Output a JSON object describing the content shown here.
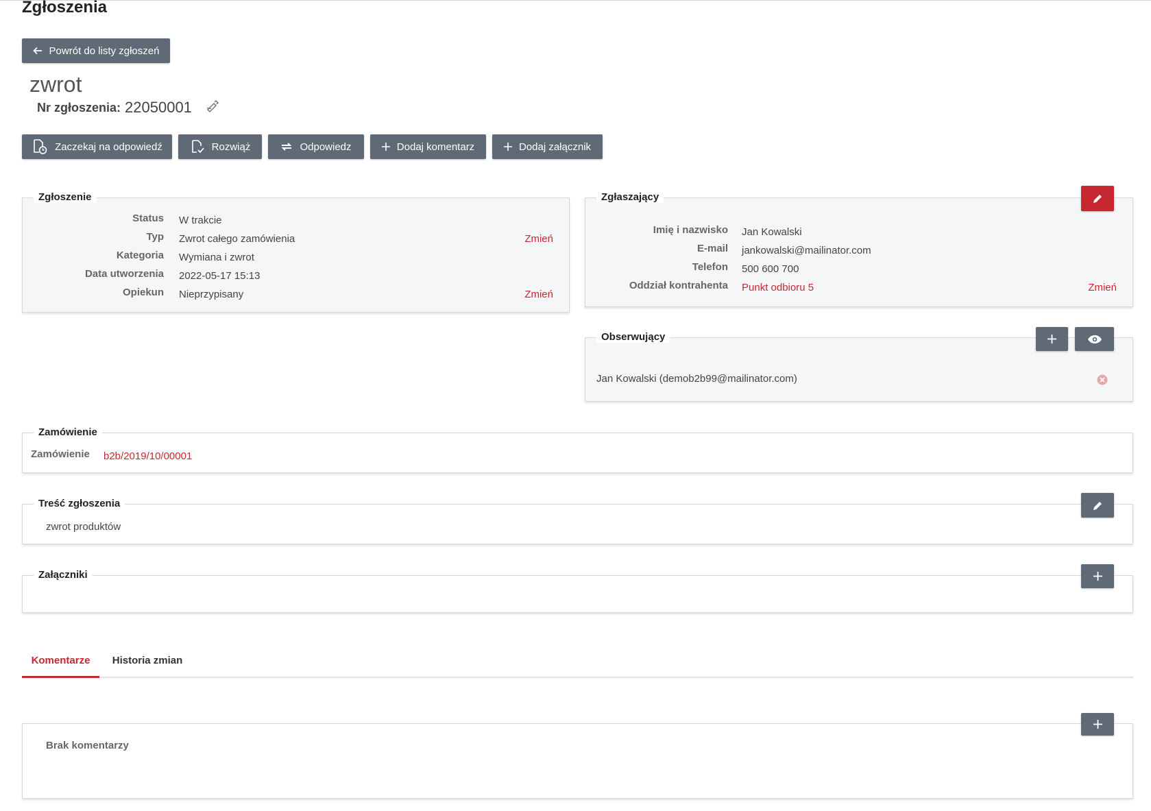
{
  "page": {
    "title": "Zgłoszenia",
    "back_button": "Powrót do listy zgłoszeń"
  },
  "ticket": {
    "title": "zwrot",
    "number_label": "Nr zgłoszenia:",
    "number_value": "22050001"
  },
  "actions": {
    "wait": "Zaczekaj na odpowiedź",
    "resolve": "Rozwiąż",
    "reply": "Odpowiedz",
    "add_comment": "Dodaj komentarz",
    "add_attachment": "Dodaj załącznik"
  },
  "zgloszenie": {
    "legend": "Zgłoszenie",
    "status_label": "Status",
    "status_value": "W trakcie",
    "type_label": "Typ",
    "type_value": "Zwrot całego zamówienia",
    "type_change": "Zmień",
    "category_label": "Kategoria",
    "category_value": "Wymiana i zwrot",
    "created_label": "Data utworzenia",
    "created_value": "2022-05-17 15:13",
    "owner_label": "Opiekun",
    "owner_value": "Nieprzypisany",
    "owner_change": "Zmień"
  },
  "zglaszajacy": {
    "legend": "Zgłaszający",
    "name_label": "Imię i nazwisko",
    "name_value": "Jan Kowalski",
    "email_label": "E-mail",
    "email_value": "jankowalski@mailinator.com",
    "phone_label": "Telefon",
    "phone_value": "500 600 700",
    "branch_label": "Oddział kontrahenta",
    "branch_value": "Punkt odbioru 5",
    "branch_change": "Zmień"
  },
  "obserwujacy": {
    "legend": "Obserwujący",
    "item": "Jan Kowalski (demob2b99@mailinator.com)"
  },
  "zamowienie": {
    "legend": "Zamówienie",
    "label": "Zamówienie",
    "value": "b2b/2019/10/00001"
  },
  "tresc": {
    "legend": "Treść zgłoszenia",
    "value": "zwrot produktów"
  },
  "zalaczniki": {
    "legend": "Załączniki"
  },
  "tabs": {
    "comments": "Komentarze",
    "history": "Historia zmian"
  },
  "comments": {
    "empty": "Brak komentarzy"
  },
  "colors": {
    "accent": "#c62832",
    "button": "#5f6a76"
  }
}
